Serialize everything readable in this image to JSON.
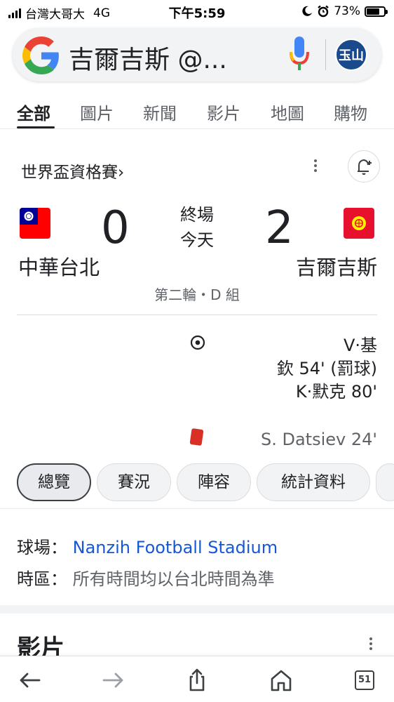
{
  "status_bar": {
    "carrier": "台灣大哥大",
    "network": "4G",
    "time": "下午5:59",
    "battery": "73%",
    "battery_level": 0.73
  },
  "search": {
    "query": "吉爾吉斯 @...",
    "avatar_text": "玉山"
  },
  "tabs": [
    {
      "label": "全部",
      "active": true
    },
    {
      "label": "圖片"
    },
    {
      "label": "新聞"
    },
    {
      "label": "影片"
    },
    {
      "label": "地圖"
    },
    {
      "label": "購物"
    }
  ],
  "match": {
    "competition": "世界盃資格賽›",
    "home_team": "中華台北",
    "home_score": "0",
    "away_team": "吉爾吉斯",
    "away_score": "2",
    "status": "終場",
    "date": "今天",
    "round": "第二輪・D 組",
    "goal_events": [
      "V·基",
      "欽 54' (罰球)",
      "K·默克 80'"
    ],
    "red_card_event": "S. Datsiev 24'"
  },
  "chips": [
    {
      "label": "總覽",
      "active": true
    },
    {
      "label": "賽況"
    },
    {
      "label": "陣容"
    },
    {
      "label": "統計資料"
    }
  ],
  "info": {
    "venue_label": "球場：",
    "venue_value": "Nanzih Football Stadium",
    "timezone_label": "時區：",
    "timezone_value": "所有時間均以台北時間為準"
  },
  "videos": {
    "title": "影片"
  },
  "bottom_nav": {
    "tab_count": "51"
  },
  "colors": {
    "link": "#1558d6",
    "red_card": "#d93025",
    "taiwan_flag_red": "#fe0000",
    "taiwan_flag_blue": "#000095",
    "kyrgyz_flag_red": "#e8112d"
  }
}
